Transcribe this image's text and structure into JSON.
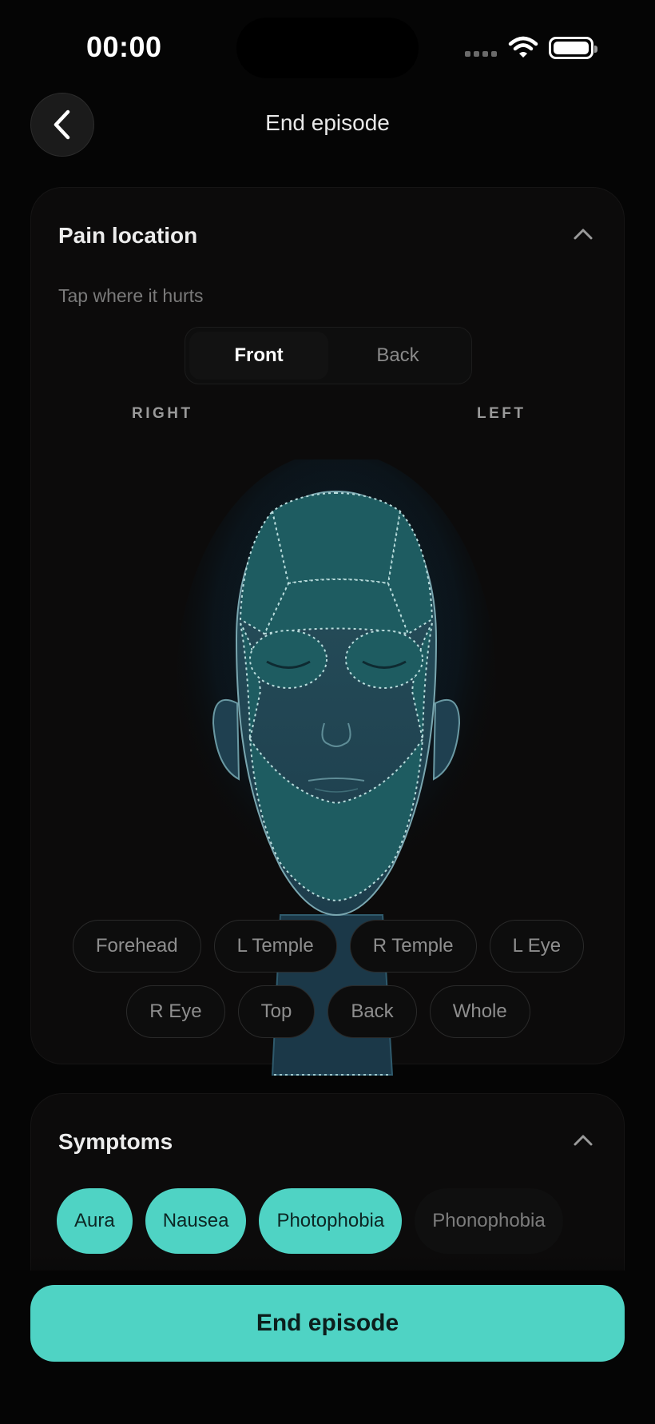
{
  "status_bar": {
    "time": "00:00"
  },
  "header": {
    "title": "End episode"
  },
  "pain_location": {
    "title": "Pain location",
    "subtitle": "Tap where it hurts",
    "view_toggle": {
      "options": [
        "Front",
        "Back"
      ],
      "selected": "Front"
    },
    "side_labels": {
      "right": "RIGHT",
      "left": "LEFT"
    },
    "regions_row1": [
      "Forehead",
      "L Temple",
      "R Temple",
      "L Eye"
    ],
    "regions_row2": [
      "R Eye",
      "Top",
      "Back",
      "Whole"
    ]
  },
  "symptoms": {
    "title": "Symptoms",
    "items": [
      {
        "label": "Aura",
        "selected": true
      },
      {
        "label": "Nausea",
        "selected": true
      },
      {
        "label": "Photophobia",
        "selected": true
      },
      {
        "label": "Phonophobia",
        "selected": false
      }
    ]
  },
  "footer": {
    "button_label": "End episode"
  },
  "colors": {
    "accent": "#4fd3c4",
    "background": "#050505",
    "card": "#0c0b0b"
  }
}
